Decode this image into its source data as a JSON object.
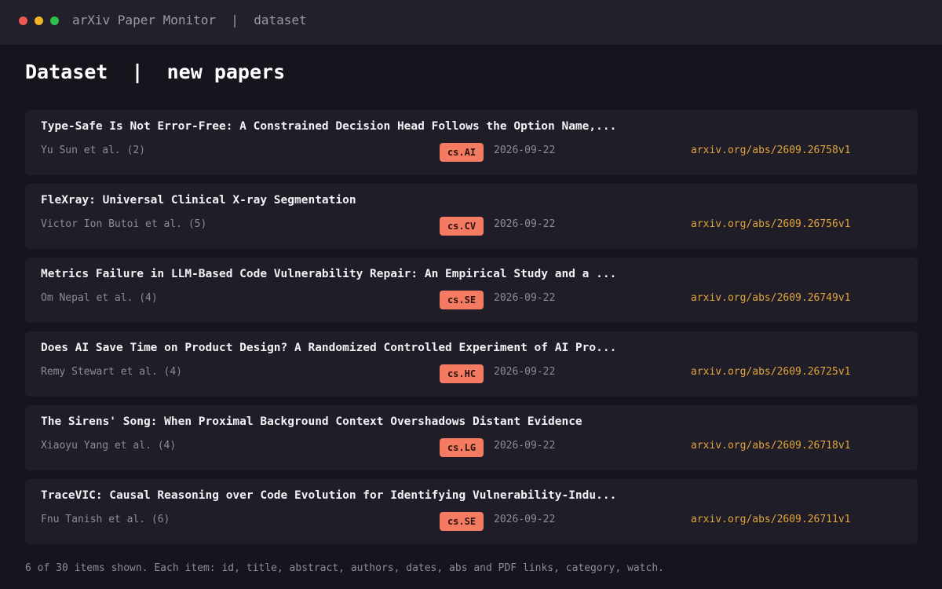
{
  "window": {
    "title": "arXiv Paper Monitor  |  dataset",
    "controls": [
      "close",
      "minimize",
      "maximize"
    ],
    "colors": {
      "close": "#ee5a52",
      "minimize": "#f0b429",
      "maximize": "#2fbf4c"
    }
  },
  "header": {
    "title": "Dataset  |  new papers"
  },
  "papers": [
    {
      "title": "Type-Safe Is Not Error-Free: A Constrained Decision Head Follows the Option Name,...",
      "authors": "Yu Sun et al. (2)",
      "category": "cs.AI",
      "date": "2026-09-22",
      "link": "arxiv.org/abs/2609.26758v1"
    },
    {
      "title": "FleXray: Universal Clinical X-ray Segmentation",
      "authors": "Victor Ion Butoi et al. (5)",
      "category": "cs.CV",
      "date": "2026-09-22",
      "link": "arxiv.org/abs/2609.26756v1"
    },
    {
      "title": "Metrics Failure in LLM-Based Code Vulnerability Repair: An Empirical Study and a ...",
      "authors": "Om Nepal et al. (4)",
      "category": "cs.SE",
      "date": "2026-09-22",
      "link": "arxiv.org/abs/2609.26749v1"
    },
    {
      "title": "Does AI Save Time on Product Design? A Randomized Controlled Experiment of AI Pro...",
      "authors": "Remy Stewart et al. (4)",
      "category": "cs.HC",
      "date": "2026-09-22",
      "link": "arxiv.org/abs/2609.26725v1"
    },
    {
      "title": "The Sirens' Song: When Proximal Background Context Overshadows Distant Evidence",
      "authors": "Xiaoyu Yang et al. (4)",
      "category": "cs.LG",
      "date": "2026-09-22",
      "link": "arxiv.org/abs/2609.26718v1"
    },
    {
      "title": "TraceVIC: Causal Reasoning over Code Evolution for Identifying Vulnerability-Indu...",
      "authors": "Fnu Tanish et al. (6)",
      "category": "cs.SE",
      "date": "2026-09-22",
      "link": "arxiv.org/abs/2609.26711v1"
    }
  ],
  "footer": {
    "text": "6 of 30 items shown. Each item: id, title, abstract, authors, dates, abs and PDF links, category, watch."
  },
  "colors": {
    "background": "#16151d",
    "card": "#1f1e28",
    "category_badge": "#f47a61",
    "link": "#e3a43a"
  }
}
